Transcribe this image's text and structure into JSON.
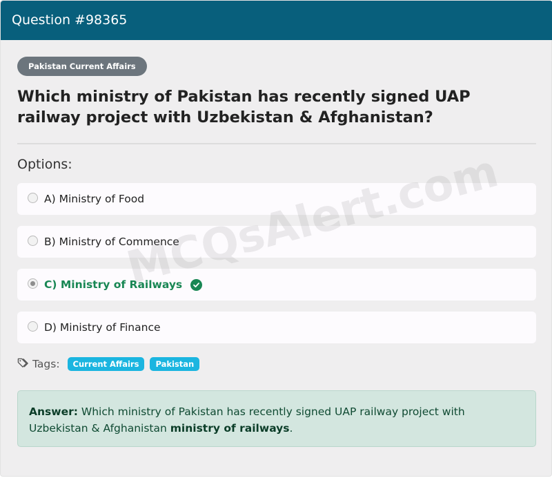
{
  "header": {
    "title": "Question #98365"
  },
  "category_badge": "Pakistan Current Affairs",
  "question": "Which ministry of Pakistan has recently signed UAP railway project with Uzbekistan & Afghanistan?",
  "options_label": "Options:",
  "options": [
    {
      "label": "A) Ministry of Food",
      "selected": false,
      "correct": false
    },
    {
      "label": "B) Ministry of Commence",
      "selected": false,
      "correct": false
    },
    {
      "label": "C) Ministry of Railways",
      "selected": true,
      "correct": true
    },
    {
      "label": "D) Ministry of Finance",
      "selected": false,
      "correct": false
    }
  ],
  "tags": {
    "label": "Tags:",
    "items": [
      "Current Affairs",
      "Pakistan"
    ]
  },
  "answer": {
    "prefix": "Answer:",
    "text": " Which ministry of Pakistan has recently signed UAP railway project with Uzbekistan & Afghanistan ",
    "highlight": "ministry of railways",
    "suffix": "."
  },
  "watermark": "MCQsAlert.com",
  "colors": {
    "header_bg": "#085f7c",
    "badge_bg": "#6c757d",
    "correct": "#198754",
    "tag_bg": "#1bb5e0",
    "answer_bg": "#d3e6df"
  }
}
